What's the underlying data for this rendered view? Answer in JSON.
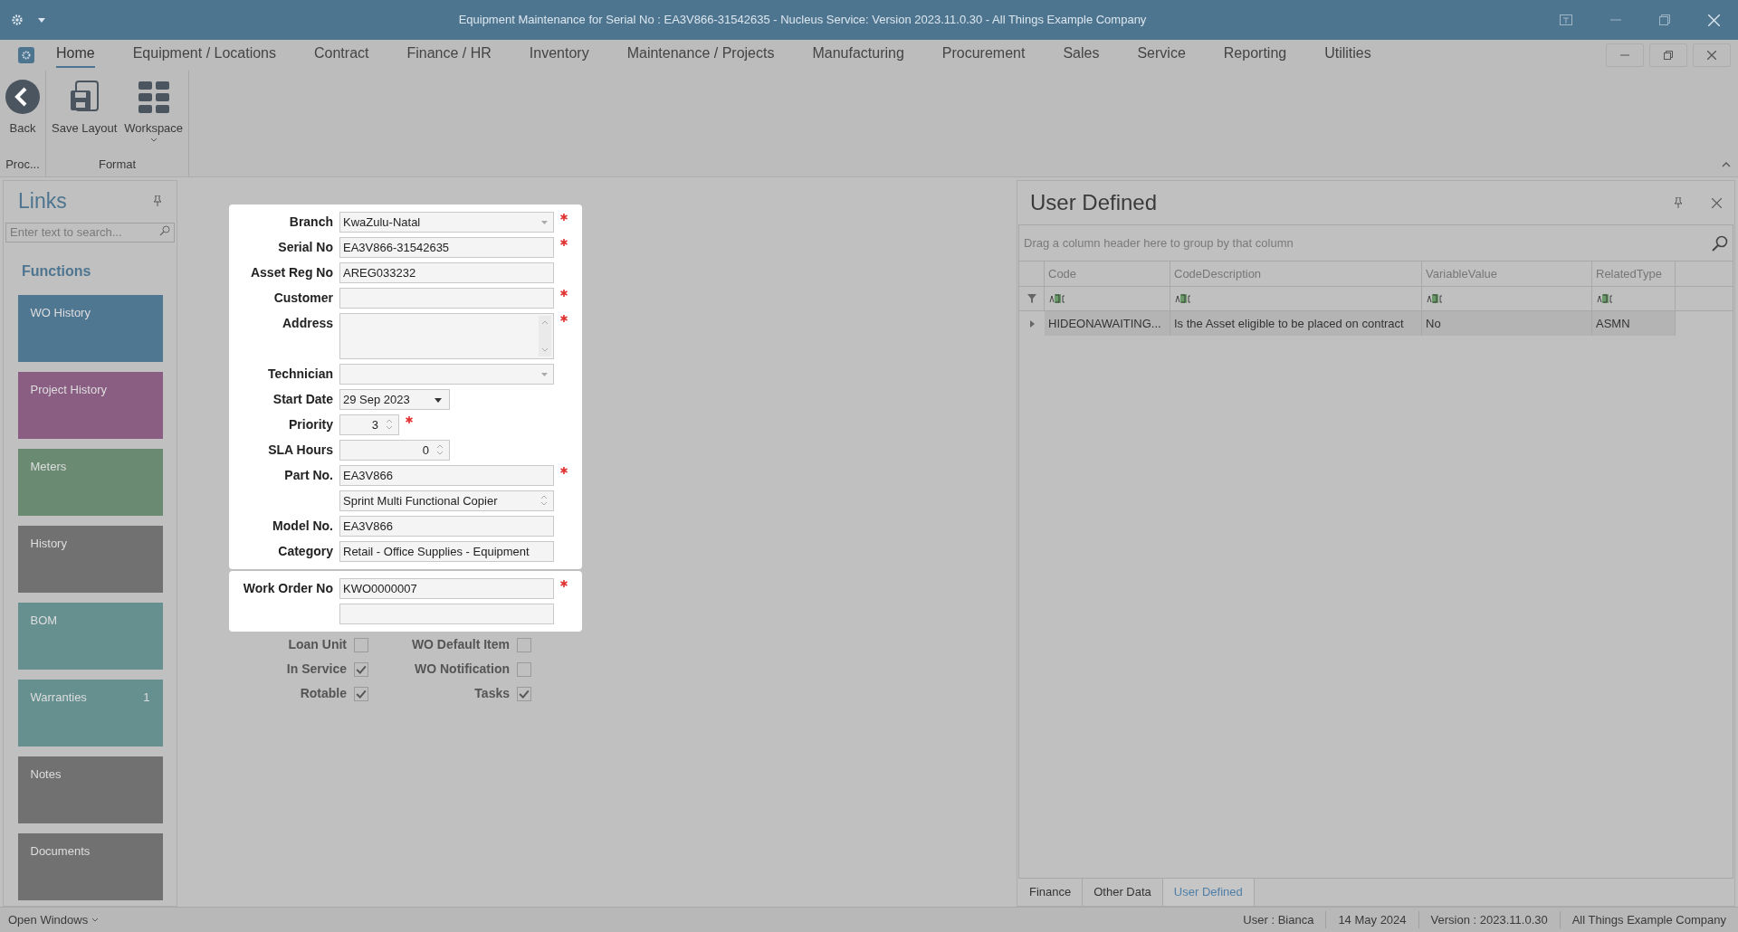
{
  "window": {
    "title": "Equipment Maintenance for Serial No : EA3V866-31542635 - Nucleus Service: Version 2023.11.0.30 - All Things Example Company"
  },
  "menu": [
    {
      "label": "Home",
      "selected": true
    },
    {
      "label": "Equipment / Locations",
      "selected": false
    },
    {
      "label": "Contract",
      "selected": false
    },
    {
      "label": "Finance / HR",
      "selected": false
    },
    {
      "label": "Inventory",
      "selected": false
    },
    {
      "label": "Maintenance / Projects",
      "selected": false
    },
    {
      "label": "Manufacturing",
      "selected": false
    },
    {
      "label": "Procurement",
      "selected": false
    },
    {
      "label": "Sales",
      "selected": false
    },
    {
      "label": "Service",
      "selected": false
    },
    {
      "label": "Reporting",
      "selected": false
    },
    {
      "label": "Utilities",
      "selected": false
    }
  ],
  "ribbon": {
    "groups": [
      {
        "label": "Proc...",
        "buttons": [
          {
            "kind": "back",
            "label": "Back"
          }
        ]
      },
      {
        "label": "Format",
        "buttons": [
          {
            "kind": "save",
            "label": "Save Layout"
          },
          {
            "kind": "workspace",
            "label": "Workspace"
          }
        ]
      }
    ]
  },
  "links": {
    "title": "Links",
    "search": {
      "placeholder": "Enter text to search..."
    },
    "section": "Functions",
    "tiles": [
      {
        "label": "WO History",
        "color": "#4f7791"
      },
      {
        "label": "Project History",
        "color": "#8a5d82"
      },
      {
        "label": "Meters",
        "color": "#6a8a72"
      },
      {
        "label": "History",
        "color": "#717171"
      },
      {
        "label": "BOM",
        "color": "#668f90"
      },
      {
        "label": "Warranties",
        "count": "1",
        "color": "#668f90"
      },
      {
        "label": "Notes",
        "color": "#717171"
      },
      {
        "label": "Documents",
        "color": "#717171"
      }
    ]
  },
  "form": {
    "sections": [
      {
        "fields": [
          {
            "label": "Branch",
            "kind": "dropdown",
            "value": "KwaZulu-Natal",
            "required": true
          },
          {
            "label": "Serial No",
            "kind": "text",
            "value": "EA3V866-31542635",
            "required": true
          },
          {
            "label": "Asset Reg No",
            "kind": "text",
            "value": "AREG033232",
            "required": false
          },
          {
            "label": "Customer",
            "kind": "text",
            "required": true
          },
          {
            "label": "Address",
            "kind": "memo",
            "required": true
          },
          {
            "label": "Technician",
            "kind": "dropdown",
            "required": false
          },
          {
            "label": "Start Date",
            "kind": "date",
            "value": "29 Sep 2023",
            "required": false
          },
          {
            "label": "Priority",
            "kind": "spin-short",
            "value": "3",
            "required": true
          },
          {
            "label": "SLA Hours",
            "kind": "spin",
            "value": "0",
            "required": false
          },
          {
            "label": "Part No.",
            "kind": "text",
            "value": "EA3V866",
            "required": true
          },
          {
            "kind": "memo-line",
            "value": "Sprint Multi Functional Copier",
            "required": false
          },
          {
            "label": "Model No.",
            "kind": "text",
            "value": "EA3V866",
            "required": false
          },
          {
            "label": "Category",
            "kind": "text",
            "value": "Retail - Office Supplies - Equipment",
            "required": false
          }
        ]
      },
      {
        "fields": [
          {
            "label": "Work Order No",
            "kind": "text",
            "value": "KWO0000007",
            "required": true
          },
          {
            "kind": "text",
            "required": false
          }
        ]
      }
    ],
    "checkboxes": [
      {
        "label": "Loan Unit",
        "checked": false
      },
      {
        "label": "WO Default Item",
        "checked": false
      },
      {
        "label": "In Service",
        "checked": true
      },
      {
        "label": "WO Notification",
        "checked": false
      },
      {
        "label": "Rotable",
        "checked": true
      },
      {
        "label": "Tasks",
        "checked": true
      }
    ]
  },
  "panel": {
    "title": "User Defined",
    "group_hint": "Drag a column header here to group by that column",
    "columns": [
      "Code",
      "CodeDescription",
      "VariableValue",
      "RelatedType"
    ],
    "rows": [
      [
        "HIDEONAWAITING...",
        "Is the Asset eligible to be placed on contract",
        "No",
        "ASMN"
      ]
    ],
    "tabs": [
      {
        "label": "Finance",
        "selected": false
      },
      {
        "label": "Other Data",
        "selected": false
      },
      {
        "label": "User Defined",
        "selected": true
      }
    ]
  },
  "status_bar": {
    "open_windows": "Open Windows",
    "items": [
      "User : Bianca",
      "14 May 2024",
      "Version : 2023.11.0.30",
      "All Things Example Company"
    ]
  }
}
